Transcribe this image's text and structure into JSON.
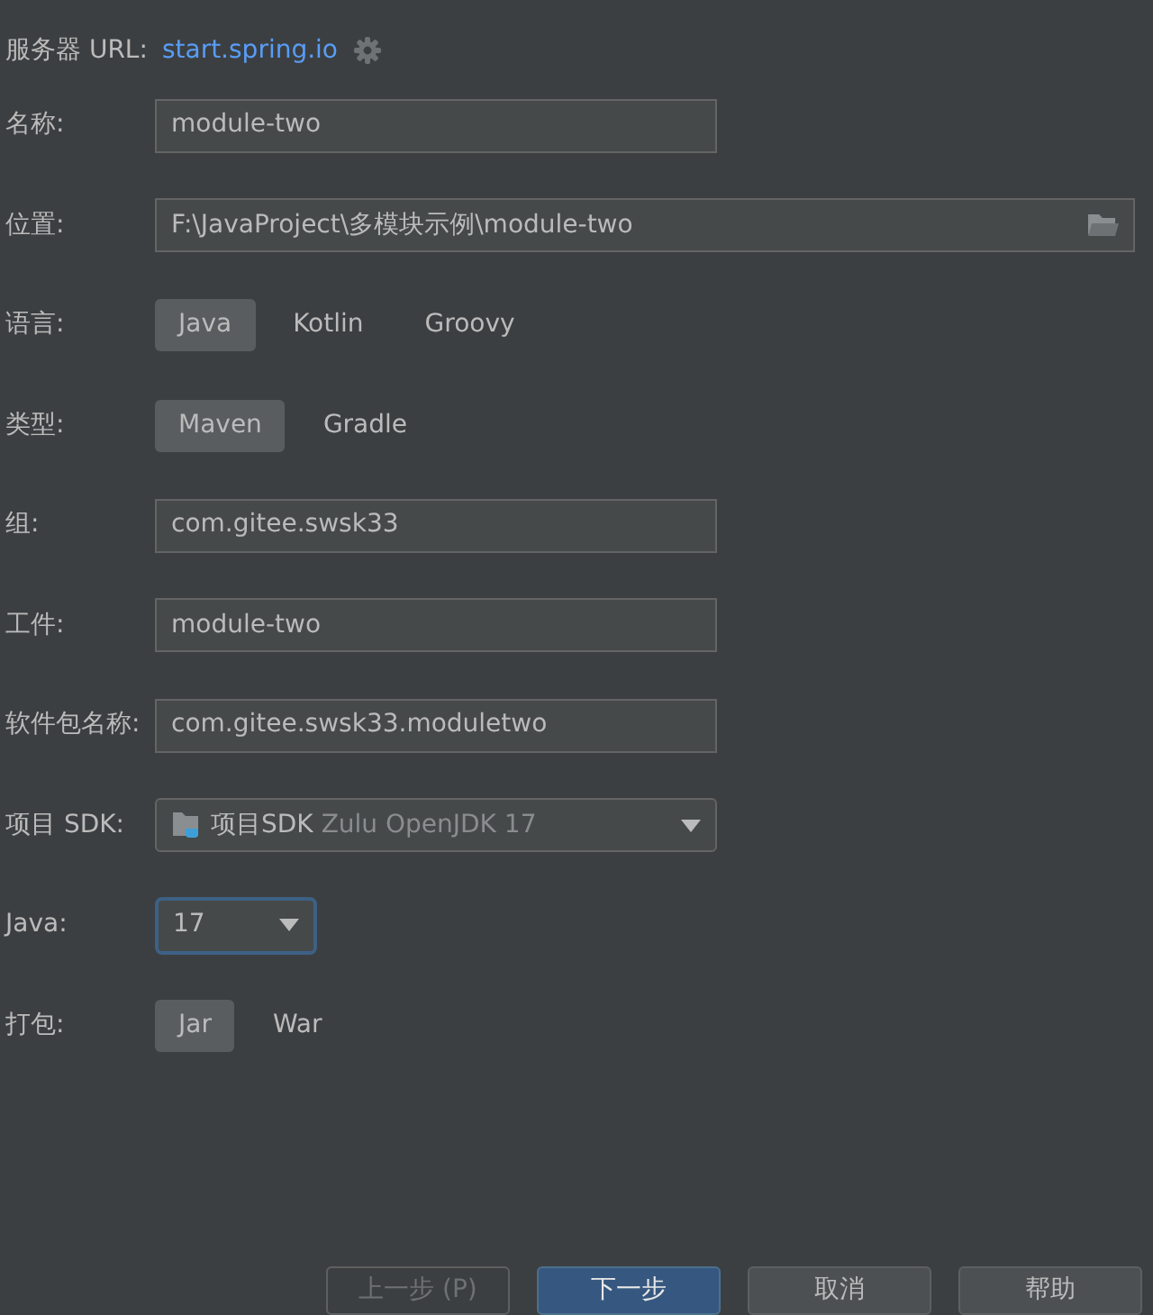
{
  "server": {
    "label": "服务器 URL:",
    "link": "start.spring.io"
  },
  "rows": [
    {
      "kind": "text",
      "label": "名称:",
      "value": "module-two"
    },
    {
      "kind": "path",
      "label": "位置:",
      "value": "F:\\JavaProject\\多模块示例\\module-two"
    },
    {
      "kind": "choice",
      "label": "语言:",
      "options": [
        {
          "label": "Java",
          "selected": true
        },
        {
          "label": "Kotlin",
          "selected": false
        },
        {
          "label": "Groovy",
          "selected": false
        }
      ]
    },
    {
      "kind": "choice",
      "label": "类型:",
      "options": [
        {
          "label": "Maven",
          "selected": true
        },
        {
          "label": "Gradle",
          "selected": false
        }
      ]
    },
    {
      "kind": "text",
      "label": "组:",
      "value": "com.gitee.swsk33"
    },
    {
      "kind": "text",
      "label": "工件:",
      "value": "module-two"
    },
    {
      "kind": "text",
      "label": "软件包名称:",
      "value": "com.gitee.swsk33.moduletwo"
    },
    {
      "kind": "sdk",
      "label": "项目 SDK:",
      "prefix": "项目SDK",
      "value": "Zulu OpenJDK 17"
    },
    {
      "kind": "select",
      "label": "Java:",
      "value": "17",
      "focused": true
    },
    {
      "kind": "choice",
      "label": "打包:",
      "options": [
        {
          "label": "Jar",
          "selected": true
        },
        {
          "label": "War",
          "selected": false
        }
      ]
    }
  ],
  "buttons": [
    {
      "label": "上一步 (P)",
      "disabled": true,
      "primary": false
    },
    {
      "label": "下一步",
      "disabled": false,
      "primary": true
    },
    {
      "label": "取消",
      "disabled": false,
      "primary": false
    },
    {
      "label": "帮助",
      "disabled": false,
      "primary": false
    }
  ]
}
